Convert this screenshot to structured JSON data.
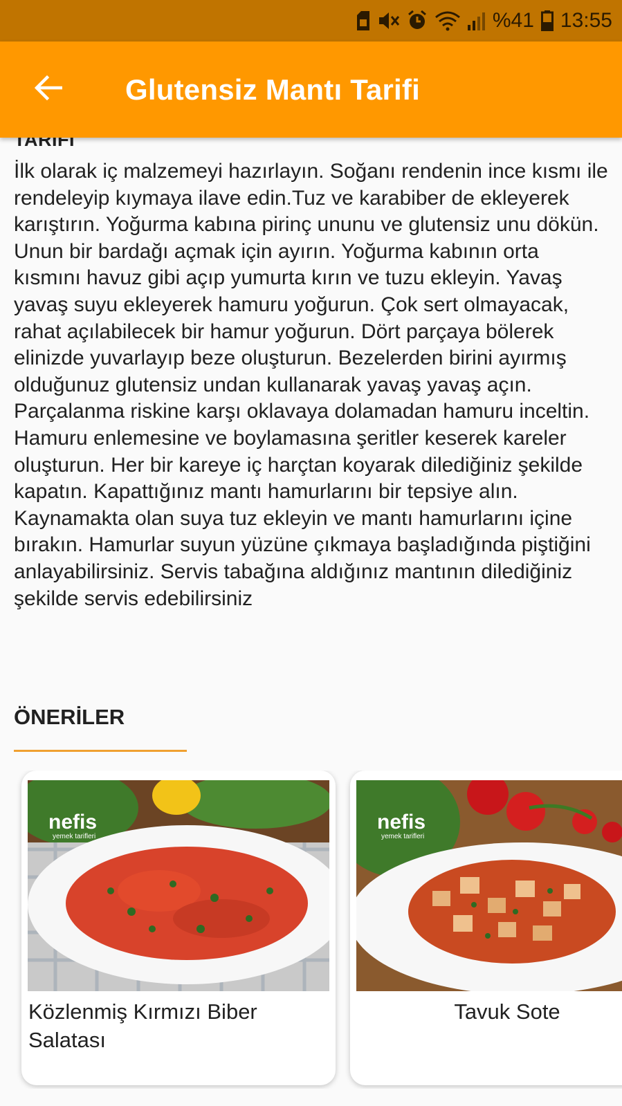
{
  "status_bar": {
    "battery_percent": "%41",
    "time": "13:55",
    "icons": [
      "sim-card-icon",
      "mute-icon",
      "alarm-icon",
      "wifi-icon",
      "signal-icon",
      "battery-icon"
    ]
  },
  "app_bar": {
    "title": "Glutensiz Mantı Tarifi",
    "back_icon": "arrow-left-icon"
  },
  "recipe": {
    "section_heading": "TARİFİ",
    "text": "İlk olarak iç malzemeyi hazırlayın. Soğanı rendenin ince kısmı ile rendeleyip kıymaya ilave edin.Tuz ve karabiber de ekleyerek karıştırın. Yoğurma kabına pirinç ununu ve glutensiz unu dökün. Unun bir bardağı açmak için ayırın. Yoğurma kabının orta kısmını havuz gibi açıp yumurta kırın ve tuzu ekleyin. Yavaş yavaş suyu ekleyerek hamuru yoğurun. Çok sert olmayacak, rahat açılabilecek bir hamur yoğurun. Dört parçaya bölerek elinizde yuvarlayıp beze oluşturun. Bezelerden birini ayırmış olduğunuz glutensiz undan kullanarak yavaş yavaş açın. Parçalanma riskine karşı oklavaya dolamadan hamuru inceltin. Hamuru enlemesine ve boylamasına şeritler keserek kareler oluşturun. Her bir kareye iç harçtan koyarak dilediğiniz şekilde kapatın. Kapattığınız mantı hamurlarını bir tepsiye alın. Kaynamakta olan suya tuz ekleyin ve mantı hamurlarını içine bırakın. Hamurlar suyun yüzüne çıkmaya başladığında piştiğini anlayabilirsiniz. Servis tabağına aldığınız mantının dilediğiniz şekilde servis edebilirsiniz"
  },
  "suggestions": {
    "heading": "ÖNERİLER",
    "accent_color": "#f0a030",
    "items": [
      {
        "title": "Közlenmiş Kırmızı Biber Salatası",
        "image_logo": "nefis",
        "image_logo_sub": "yemek tarifleri"
      },
      {
        "title": "Tavuk Sote",
        "image_logo": "nefis",
        "image_logo_sub": "yemek tarifleri"
      }
    ]
  },
  "colors": {
    "status_bar": "#c07400",
    "app_bar": "#ff9800",
    "background": "#fafafa"
  }
}
